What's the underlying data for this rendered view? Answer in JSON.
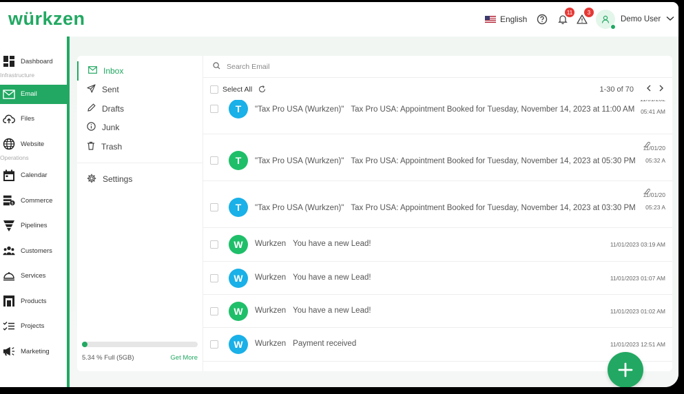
{
  "header": {
    "logo": "würkzen",
    "language": "English",
    "notifications_count": "11",
    "alerts_count": "3",
    "user_name": "Demo User"
  },
  "nav": {
    "items": [
      {
        "label": "Dashboard",
        "icon": "dashboard-icon"
      },
      {
        "section": "Infrastructure"
      },
      {
        "label": "Email",
        "icon": "mail-icon",
        "active": true
      },
      {
        "label": "Files",
        "icon": "cloud-upload-icon"
      },
      {
        "label": "Website",
        "icon": "globe-icon"
      },
      {
        "section": "Operations"
      },
      {
        "label": "Calendar",
        "icon": "calendar-icon"
      },
      {
        "label": "Commerce",
        "icon": "commerce-icon"
      },
      {
        "label": "Pipelines",
        "icon": "funnel-icon"
      },
      {
        "label": "Customers",
        "icon": "people-icon"
      },
      {
        "label": "Services",
        "icon": "cloche-icon"
      },
      {
        "label": "Products",
        "icon": "store-icon"
      },
      {
        "label": "Projects",
        "icon": "checklist-icon"
      },
      {
        "label": "Marketing",
        "icon": "megaphone-icon"
      }
    ]
  },
  "folders": {
    "inbox": "Inbox",
    "sent": "Sent",
    "drafts": "Drafts",
    "junk": "Junk",
    "trash": "Trash",
    "settings": "Settings"
  },
  "storage": {
    "used_fraction": 0.0534,
    "text": "5.34 % Full (5GB)",
    "get_more": "Get More"
  },
  "search": {
    "placeholder": "Search Email"
  },
  "list": {
    "select_all": "Select All",
    "pagination": "1-30 of 70",
    "rows": [
      {
        "letter": "T",
        "color": "#1ab0e8",
        "sender": "\"Tax Pro USA (Wurkzen)\"",
        "subject": "Tax Pro USA: Appointment Booked for Tuesday, November 14, 2023 at 11:00 AM",
        "date": "11/01/202",
        "time": "05:41 AM",
        "attachment": true
      },
      {
        "letter": "T",
        "color": "#1fbf6a",
        "sender": "\"Tax Pro USA (Wurkzen)\"",
        "subject": "Tax Pro USA: Appointment Booked for Tuesday, November 14, 2023 at 05:30 PM",
        "date": "11/01/20",
        "time": "05:32 A",
        "attachment": true
      },
      {
        "letter": "T",
        "color": "#1ab0e8",
        "sender": "\"Tax Pro USA (Wurkzen)\"",
        "subject": "Tax Pro USA: Appointment Booked for Tuesday, November 14, 2023 at 03:30 PM",
        "date": "11/01/20",
        "time": "05:23 A",
        "attachment": true
      },
      {
        "letter": "W",
        "color": "#1fbf6a",
        "sender": "Wurkzen",
        "subject": "You have a new Lead!",
        "date": "11/01/2023 03:19 AM"
      },
      {
        "letter": "W",
        "color": "#1ab0e8",
        "sender": "Wurkzen",
        "subject": "You have a new Lead!",
        "date": "11/01/2023 01:07 AM"
      },
      {
        "letter": "W",
        "color": "#1fbf6a",
        "sender": "Wurkzen",
        "subject": "You have a new Lead!",
        "date": "11/01/2023 01:02 AM"
      },
      {
        "letter": "W",
        "color": "#1ab0e8",
        "sender": "Wurkzen",
        "subject": "Payment received",
        "date": "11/01/2023 12:51 AM"
      }
    ]
  },
  "fab": {
    "icon": "plus-icon"
  },
  "colors": {
    "brand": "#22a862"
  }
}
